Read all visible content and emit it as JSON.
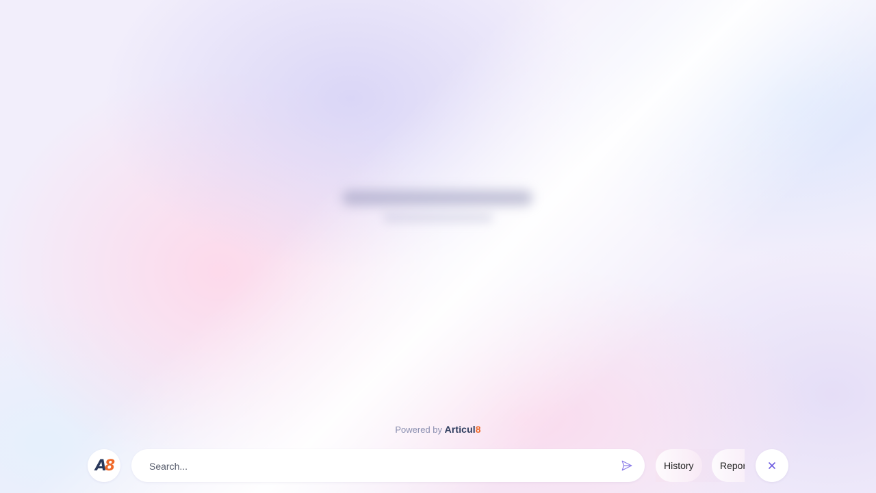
{
  "powered": {
    "prefix": "Powered by",
    "brand_main": "Articul",
    "brand_accent": "8"
  },
  "logo": {
    "a": "A",
    "three": "8",
    "icon": "articul8-logo-icon"
  },
  "search": {
    "placeholder": "Search...",
    "value": "",
    "send_icon": "send-icon"
  },
  "pills": {
    "history_label": "History",
    "reports_label": "Reports"
  },
  "close": {
    "icon": "close-icon"
  },
  "colors": {
    "brand_dark": "#2b3a5c",
    "brand_accent": "#f06a2a",
    "icon_accent": "#6d5be0"
  }
}
